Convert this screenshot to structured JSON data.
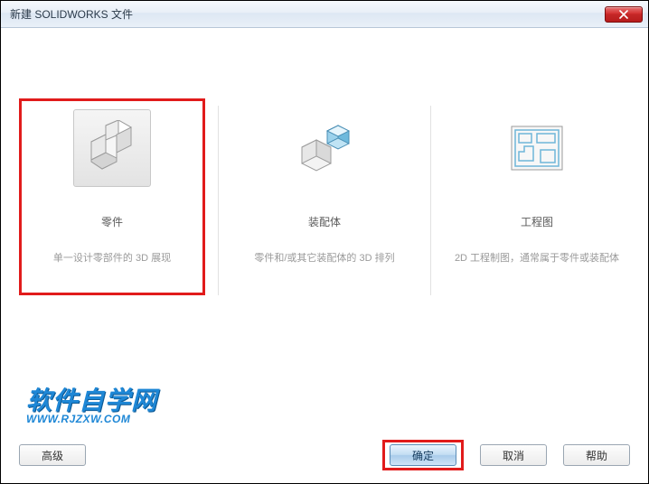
{
  "window": {
    "title": "新建 SOLIDWORKS 文件"
  },
  "options": {
    "part": {
      "title": "零件",
      "desc": "单一设计零部件的 3D 展现"
    },
    "assembly": {
      "title": "装配体",
      "desc": "零件和/或其它装配体的 3D 排列"
    },
    "drawing": {
      "title": "工程图",
      "desc": "2D 工程制图，通常属于零件或装配体"
    }
  },
  "buttons": {
    "advanced": "高级",
    "ok": "确定",
    "cancel": "取消",
    "help": "帮助"
  },
  "watermark": {
    "line1": "软件自学网",
    "line2": "WWW.RJZXW.COM"
  }
}
